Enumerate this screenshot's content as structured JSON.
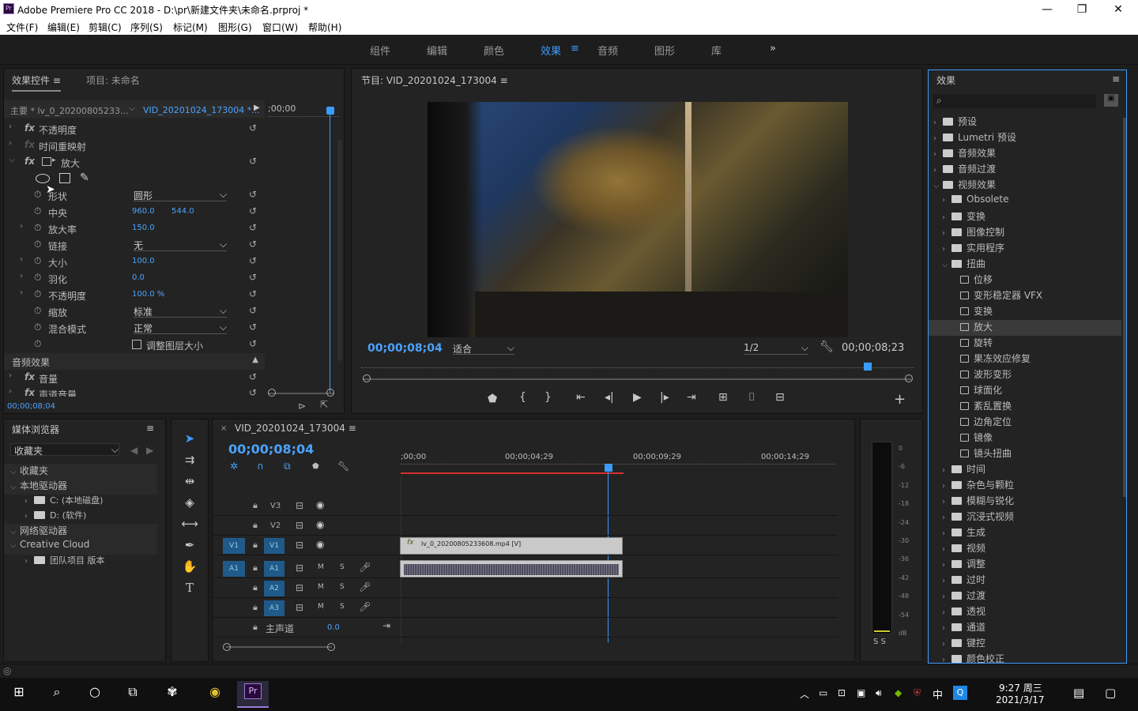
{
  "titlebar": {
    "title": "Adobe Premiere Pro CC 2018 - D:\\pr\\新建文件夹\\未命名.prproj *",
    "logo": "Pr"
  },
  "menu": [
    "文件(F)",
    "编辑(E)",
    "剪辑(C)",
    "序列(S)",
    "标记(M)",
    "图形(G)",
    "窗口(W)",
    "帮助(H)"
  ],
  "workspaces": [
    "组件",
    "编辑",
    "颜色",
    "效果",
    "音频",
    "图形",
    "库"
  ],
  "effect_controls": {
    "tab": "效果控件",
    "tab2": "项目: 未命名",
    "master": "主要 * lv_0_20200805233...",
    "seq": "VID_20201024_173004 *...",
    "ruler_time": ";00;00",
    "rows": {
      "opacity": "不透明度",
      "timeremap": "时间重映射",
      "magnify": "放大",
      "shape": "形状",
      "shape_val": "圆形",
      "center": "中央",
      "center_x": "960.0",
      "center_y": "544.0",
      "ratio": "放大率",
      "ratio_val": "150.0",
      "link": "链接",
      "link_val": "无",
      "size": "大小",
      "size_val": "100.0",
      "feather": "羽化",
      "feather_val": "0.0",
      "opacity2": "不透明度",
      "opacity2_val": "100.0 %",
      "scale": "缩放",
      "scale_val": "标准",
      "blend": "混合模式",
      "blend_val": "正常",
      "resize": "调整图层大小",
      "audio_fx": "音频效果",
      "volume": "音量",
      "channel_vol": "声道音量"
    },
    "time": "00;00;08;04"
  },
  "program": {
    "tab": "节目: VID_20201024_173004",
    "tc": "00;00;08;04",
    "fit": "适合",
    "res": "1/2",
    "duration": "00;00;08;23"
  },
  "effects": {
    "tab": "效果",
    "items": [
      {
        "d": 0,
        "t": "预设",
        "e": false
      },
      {
        "d": 0,
        "t": "Lumetri 预设",
        "e": false
      },
      {
        "d": 0,
        "t": "音频效果",
        "e": false
      },
      {
        "d": 0,
        "t": "音频过渡",
        "e": false
      },
      {
        "d": 0,
        "t": "视频效果",
        "e": true
      },
      {
        "d": 1,
        "t": "Obsolete",
        "e": false
      },
      {
        "d": 1,
        "t": "变换",
        "e": false
      },
      {
        "d": 1,
        "t": "图像控制",
        "e": false
      },
      {
        "d": 1,
        "t": "实用程序",
        "e": false
      },
      {
        "d": 1,
        "t": "扭曲",
        "e": true
      },
      {
        "d": 2,
        "t": "位移"
      },
      {
        "d": 2,
        "t": "变形稳定器 VFX"
      },
      {
        "d": 2,
        "t": "变换"
      },
      {
        "d": 2,
        "t": "放大",
        "sel": true
      },
      {
        "d": 2,
        "t": "旋转"
      },
      {
        "d": 2,
        "t": "果冻效应修复"
      },
      {
        "d": 2,
        "t": "波形变形"
      },
      {
        "d": 2,
        "t": "球面化"
      },
      {
        "d": 2,
        "t": "紊乱置换"
      },
      {
        "d": 2,
        "t": "边角定位"
      },
      {
        "d": 2,
        "t": "镜像"
      },
      {
        "d": 2,
        "t": "镜头扭曲"
      },
      {
        "d": 1,
        "t": "时间",
        "e": false
      },
      {
        "d": 1,
        "t": "杂色与颗粒",
        "e": false
      },
      {
        "d": 1,
        "t": "模糊与锐化",
        "e": false
      },
      {
        "d": 1,
        "t": "沉浸式视频",
        "e": false
      },
      {
        "d": 1,
        "t": "生成",
        "e": false
      },
      {
        "d": 1,
        "t": "视频",
        "e": false
      },
      {
        "d": 1,
        "t": "调整",
        "e": false
      },
      {
        "d": 1,
        "t": "过时",
        "e": false
      },
      {
        "d": 1,
        "t": "过渡",
        "e": false
      },
      {
        "d": 1,
        "t": "透视",
        "e": false
      },
      {
        "d": 1,
        "t": "通道",
        "e": false
      },
      {
        "d": 1,
        "t": "键控",
        "e": false
      },
      {
        "d": 1,
        "t": "颜色校正",
        "e": false
      }
    ]
  },
  "media": {
    "tab": "媒体浏览器",
    "fav_dd": "收藏夹",
    "items": [
      {
        "d": 0,
        "t": "收藏夹"
      },
      {
        "d": 0,
        "t": "本地驱动器"
      },
      {
        "d": 1,
        "t": "C: (本地磁盘)"
      },
      {
        "d": 1,
        "t": "D: (软件)"
      },
      {
        "d": 0,
        "t": "网络驱动器"
      },
      {
        "d": 0,
        "t": "Creative Cloud"
      },
      {
        "d": 1,
        "t": "团队项目 版本"
      }
    ]
  },
  "timeline": {
    "tab": "VID_20201024_173004",
    "tc": "00;00;08;04",
    "ruler": [
      ";00;00",
      "00;00;04;29",
      "00;00;09;29",
      "00;00;14;29"
    ],
    "tracks": [
      "V3",
      "V2",
      "V1",
      "A1",
      "A2",
      "A3"
    ],
    "src_v": "V1",
    "src_a": "A1",
    "master": "主声道",
    "master_val": "0.0",
    "clip": "lv_0_20200805233608.mp4 [V]"
  },
  "meter": [
    "0",
    "-6",
    "-12",
    "-18",
    "-24",
    "-30",
    "-36",
    "-42",
    "-48",
    "-54",
    "dB"
  ],
  "meter_ss": "S  S",
  "taskbar": {
    "time": "9:27 周三",
    "date": "2021/3/17",
    "ime": "中"
  }
}
